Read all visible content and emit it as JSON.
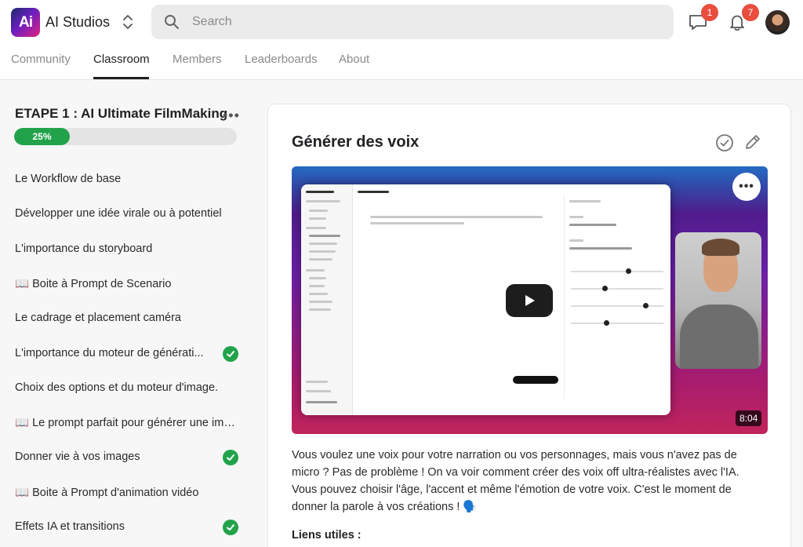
{
  "app": {
    "name": "AI Studios",
    "logo_text": "Ai"
  },
  "search": {
    "placeholder": "Search"
  },
  "notifications": {
    "messages_count": "1",
    "alerts_count": "7"
  },
  "tabs": [
    {
      "label": "Community"
    },
    {
      "label": "Classroom",
      "active": true
    },
    {
      "label": "Members"
    },
    {
      "label": "Leaderboards"
    },
    {
      "label": "About"
    }
  ],
  "course": {
    "title": "ETAPE 1 : AI Ultimate FilmMaking",
    "progress_label": "25%",
    "progress": 0.25,
    "lessons": [
      {
        "label": "Le Workflow de base",
        "completed": false
      },
      {
        "label": "Développer une idée virale ou à potentiel",
        "completed": false
      },
      {
        "label": "L'importance du storyboard",
        "completed": false
      },
      {
        "label": "📖 Boite à Prompt de Scenario",
        "completed": false
      },
      {
        "label": "Le cadrage et placement caméra",
        "completed": false
      },
      {
        "label": "L'importance du moteur de générati...",
        "completed": true
      },
      {
        "label": "Choix des options et du moteur d'image.",
        "completed": false
      },
      {
        "label": "📖 Le prompt parfait pour générer une ima...",
        "completed": false
      },
      {
        "label": "Donner vie à vos images",
        "completed": true
      },
      {
        "label": "📖 Boite à Prompt d'animation vidéo",
        "completed": false
      },
      {
        "label": "Effets IA et transitions",
        "completed": true
      }
    ]
  },
  "lesson": {
    "title": "Générer des voix",
    "video_duration": "8:04",
    "description": "Vous voulez une voix pour votre narration ou vos personnages, mais vous n'avez pas de micro ? Pas de problème ! On va voir comment créer des voix off ultra-réalistes avec l'IA. Vous pouvez choisir l'âge, l'accent et même l'émotion de votre voix. C'est le moment de donner la parole à vos créations ! 🗣️",
    "links_label": "Liens utiles :"
  },
  "colors": {
    "accent_green": "#22a34b",
    "badge_red": "#e84d3d"
  }
}
